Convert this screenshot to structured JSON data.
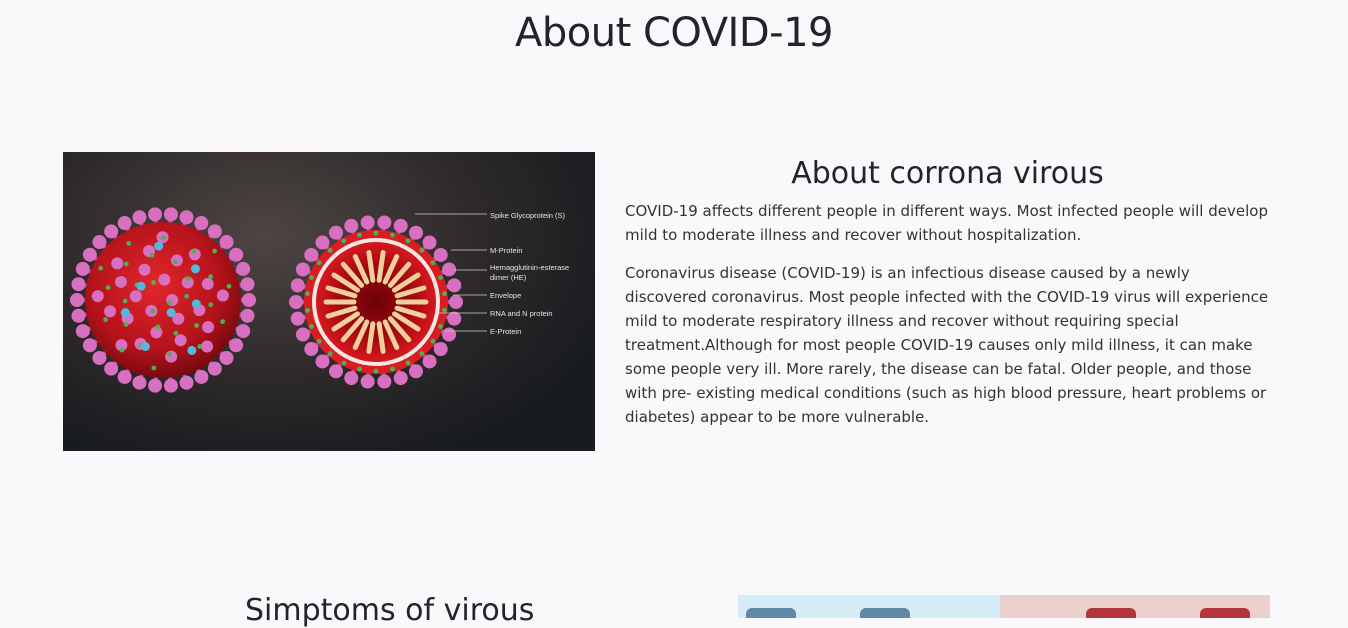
{
  "page": {
    "title": "About COVID-19"
  },
  "about": {
    "heading": "About corrona virous",
    "paragraphs": [
      "COVID-19 affects different people in different ways. Most infected people will develop mild to moderate illness and recover without hospitalization.",
      "Coronavirus disease (COVID-19) is an infectious disease caused by a newly discovered coronavirus. Most people infected with the COVID-19 virus will experience mild to moderate respiratory illness and recover without requiring special treatment.Although for most people COVID-19 causes only mild illness, it can make some people very ill. More rarely, the disease can be fatal. Older people, and those with pre- existing medical conditions (such as high blood pressure, heart problems or diabetes) appear to be more vulnerable."
    ]
  },
  "virus_diagram": {
    "labels": [
      "Spike Glycoprotein (S)",
      "M-Protein",
      "Hemagglutinin-esterase",
      "dimer (HE)",
      "Envelope",
      "RNA and N protein",
      "E-Protein"
    ],
    "colors": {
      "body": "#c4161c",
      "spike": "#d96fc0",
      "m_protein": "#4ab34f",
      "he": "#53b8dc",
      "rna": "#f0cf9c"
    }
  },
  "symptoms": {
    "heading": "Simptoms of virous"
  },
  "colors": {
    "background": "#f9f9fb",
    "text": "#212529"
  }
}
